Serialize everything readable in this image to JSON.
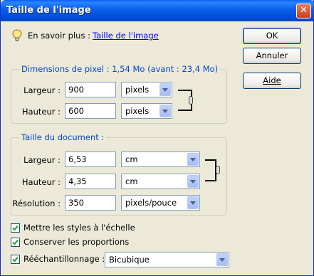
{
  "window": {
    "title": "Taille de l'image"
  },
  "info": {
    "prefix": "En savoir plus :",
    "link": "Taille de l'image"
  },
  "buttons": {
    "ok": "OK",
    "cancel": "Annuler",
    "help": "Aide"
  },
  "pixel_dimensions": {
    "legend": "Dimensions de pixel :  1,54 Mo (avant : 23,4 Mo)",
    "width_label": "Largeur :",
    "width_value": "900",
    "width_unit": "pixels",
    "height_label": "Hauteur :",
    "height_value": "600",
    "height_unit": "pixels"
  },
  "document_size": {
    "legend": "Taille du document :",
    "width_label": "Largeur :",
    "width_value": "6,53",
    "width_unit": "cm",
    "height_label": "Hauteur :",
    "height_value": "4,35",
    "height_unit": "cm",
    "resolution_label": "Résolution :",
    "resolution_value": "350",
    "resolution_unit": "pixels/pouce"
  },
  "options": {
    "scale_styles": {
      "label": "Mettre les styles à l'échelle",
      "checked": true
    },
    "constrain": {
      "label": "Conserver les proportions",
      "checked": true
    },
    "resample": {
      "label": "Rééchantillonnage :",
      "checked": true,
      "method": "Bicubique"
    }
  },
  "colors": {
    "accent": "#0046d5",
    "title_bar": "#0350d8",
    "background": "#ece9d8"
  },
  "icons": {
    "info": "lightbulb-icon",
    "link": "chain-link-icon",
    "close": "close-icon",
    "dropdown": "chevron-down-icon"
  }
}
